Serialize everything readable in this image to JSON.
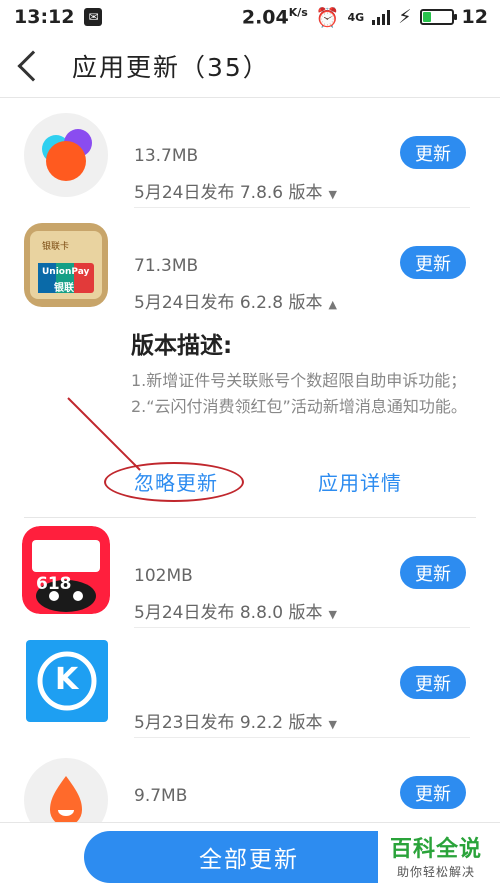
{
  "status_bar": {
    "time": "13:12",
    "net_speed": "2.04",
    "net_unit": "K/s",
    "network_type": "4G",
    "battery_level": "12"
  },
  "header": {
    "title": "应用更新（35）"
  },
  "apps": [
    {
      "icon": "circles-app-icon",
      "size": "13.7MB",
      "meta": "5月24日发布 7.8.6 版本",
      "button": "更新"
    },
    {
      "icon": "unionpay-card-icon",
      "icon_text_top": "银联卡",
      "icon_text_brand": "UnionPay",
      "icon_text_cn": "银联",
      "size": "71.3MB",
      "meta": "5月24日发布 6.2.8 版本",
      "button": "更新"
    },
    {
      "icon": "tmall-618-icon",
      "icon_text": "618",
      "size": "102MB",
      "meta": "5月24日发布 8.8.0 版本",
      "button": "更新"
    },
    {
      "icon": "kugou-k-icon",
      "icon_text": "K",
      "size": "",
      "meta": "5月23日发布 9.2.2 版本",
      "button": "更新"
    },
    {
      "icon": "drop-app-icon",
      "size": "9.7MB",
      "meta": "",
      "button": "更新"
    }
  ],
  "expanded": {
    "title": "版本描述:",
    "text": "1.新增证件号关联账号个数超限自助申诉功能；2.“云闪付消费领红包”活动新增消息通知功能。",
    "ignore_label": "忽略更新",
    "detail_label": "应用详情"
  },
  "bottom": {
    "update_all": "全部更新"
  },
  "watermark": {
    "title": "百科全说",
    "sub": "助你轻松解决"
  },
  "colors": {
    "accent": "#2d8cf0",
    "annotation": "#c0272d"
  }
}
